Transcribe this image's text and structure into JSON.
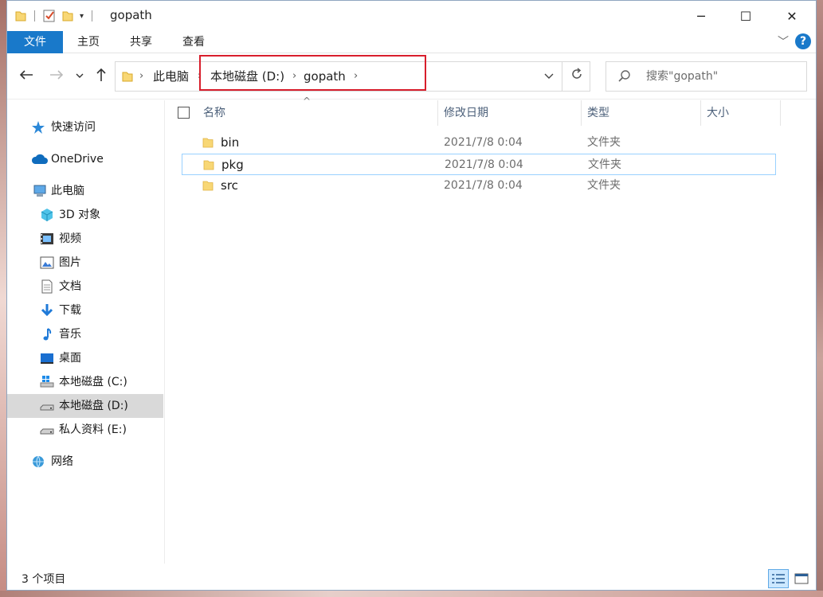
{
  "window": {
    "title": "gopath",
    "controls": {
      "minimize": "─",
      "maximize": "☐",
      "close": "✕"
    }
  },
  "ribbon": {
    "tabs": [
      {
        "label": "文件",
        "active": true
      },
      {
        "label": "主页"
      },
      {
        "label": "共享"
      },
      {
        "label": "查看"
      }
    ],
    "help": "?"
  },
  "navbar": {
    "back_icon": "arrow-left-icon",
    "forward_icon": "arrow-right-icon",
    "up_icon": "arrow-up-icon",
    "breadcrumb": [
      "此电脑",
      "本地磁盘 (D:)",
      "gopath"
    ],
    "search_placeholder": "搜索\"gopath\""
  },
  "sidebar": {
    "items": [
      {
        "label": "快速访问",
        "icon": "star-icon"
      },
      {
        "label": "OneDrive",
        "icon": "cloud-icon"
      },
      {
        "label": "此电脑",
        "icon": "computer-icon"
      },
      {
        "label": "3D 对象",
        "icon": "cube-icon"
      },
      {
        "label": "视频",
        "icon": "video-icon"
      },
      {
        "label": "图片",
        "icon": "picture-icon"
      },
      {
        "label": "文档",
        "icon": "document-icon"
      },
      {
        "label": "下载",
        "icon": "download-icon"
      },
      {
        "label": "音乐",
        "icon": "music-icon"
      },
      {
        "label": "桌面",
        "icon": "desktop-icon"
      },
      {
        "label": "本地磁盘 (C:)",
        "icon": "drive-c-icon"
      },
      {
        "label": "本地磁盘 (D:)",
        "icon": "drive-icon",
        "selected": true
      },
      {
        "label": "私人资料 (E:)",
        "icon": "drive-icon"
      },
      {
        "label": "网络",
        "icon": "network-icon"
      }
    ]
  },
  "list": {
    "columns": [
      "名称",
      "修改日期",
      "类型",
      "大小"
    ],
    "rows": [
      {
        "name": "bin",
        "date": "2021/7/8 0:04",
        "type": "文件夹",
        "size": ""
      },
      {
        "name": "pkg",
        "date": "2021/7/8 0:04",
        "type": "文件夹",
        "size": "",
        "selected": true
      },
      {
        "name": "src",
        "date": "2021/7/8 0:04",
        "type": "文件夹",
        "size": ""
      }
    ]
  },
  "status": {
    "text": "3 个项目"
  },
  "colors": {
    "accent": "#1979ca",
    "highlight_box": "#d81e2c",
    "folder": "#f8d775"
  }
}
